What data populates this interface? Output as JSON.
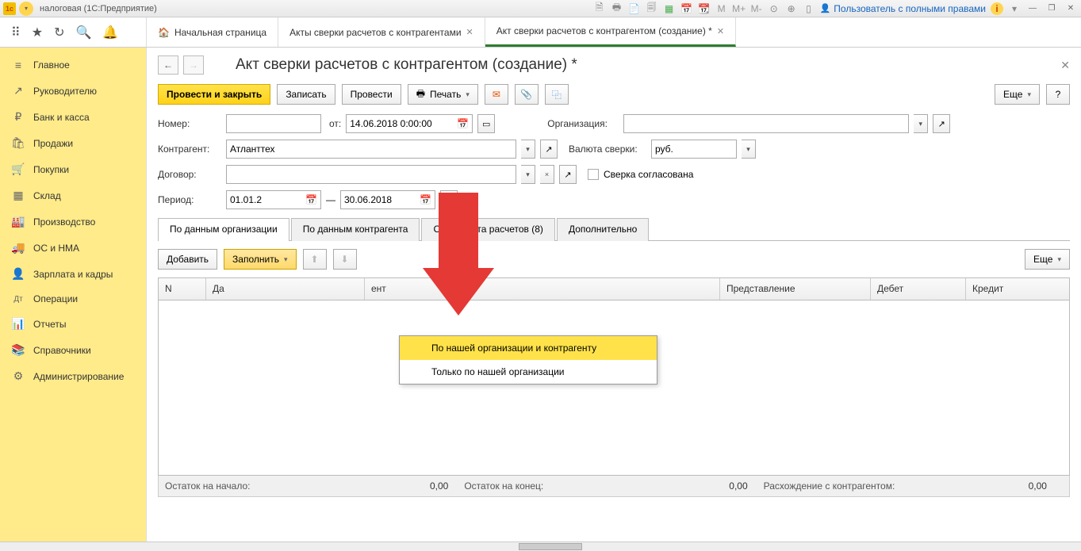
{
  "titlebar": {
    "app": "налоговая  (1С:Предприятие)",
    "user": "Пользователь с полными правами"
  },
  "topTabs": {
    "home": "Начальная страница",
    "t1": "Акты сверки расчетов с контрагентами",
    "t2": "Акт сверки расчетов с контрагентом (создание) *"
  },
  "sidebar": {
    "items": [
      {
        "icon": "≡",
        "label": "Главное"
      },
      {
        "icon": "↗",
        "label": "Руководителю"
      },
      {
        "icon": "₽",
        "label": "Банк и касса"
      },
      {
        "icon": "🛍",
        "label": "Продажи"
      },
      {
        "icon": "🛒",
        "label": "Покупки"
      },
      {
        "icon": "▦",
        "label": "Склад"
      },
      {
        "icon": "🏭",
        "label": "Производство"
      },
      {
        "icon": "🚚",
        "label": "ОС и НМА"
      },
      {
        "icon": "👤",
        "label": "Зарплата и кадры"
      },
      {
        "icon": "Дт",
        "label": "Операции"
      },
      {
        "icon": "📊",
        "label": "Отчеты"
      },
      {
        "icon": "📚",
        "label": "Справочники"
      },
      {
        "icon": "⚙",
        "label": "Администрирование"
      }
    ]
  },
  "doc": {
    "title": "Акт сверки расчетов с контрагентом (создание) *",
    "buttons": {
      "post_close": "Провести и закрыть",
      "save": "Записать",
      "post": "Провести",
      "print": "Печать",
      "more": "Еще"
    },
    "fields": {
      "number_lbl": "Номер:",
      "from_lbl": "от:",
      "from_val": "14.06.2018  0:00:00",
      "org_lbl": "Организация:",
      "contr_lbl": "Контрагент:",
      "contr_val": "Атланттех",
      "currency_lbl": "Валюта сверки:",
      "currency_val": "руб.",
      "contract_lbl": "Договор:",
      "agreed_lbl": "Сверка согласована",
      "period_lbl": "Период:",
      "period_from": "01.01.2",
      "period_to": "30.06.2018",
      "period_btn": "..."
    },
    "tabs": {
      "t1": "По данным организации",
      "t2": "По данным контрагента",
      "t3": "Счета учета расчетов (8)",
      "t4": "Дополнительно"
    },
    "tableToolbar": {
      "add": "Добавить",
      "fill": "Заполнить",
      "more": "Еще"
    },
    "tableHeaders": {
      "n": "N",
      "date": "Да",
      "doc": "ент",
      "rep": "Представление",
      "deb": "Дебет",
      "cred": "Кредит"
    },
    "totals": {
      "start_lbl": "Остаток на начало:",
      "start_val": "0,00",
      "end_lbl": "Остаток на конец:",
      "end_val": "0,00",
      "diff_lbl": "Расхождение с контрагентом:",
      "diff_val": "0,00"
    },
    "menu": {
      "m1": "По нашей организации и контрагенту",
      "m2": "Только по нашей организации"
    }
  }
}
